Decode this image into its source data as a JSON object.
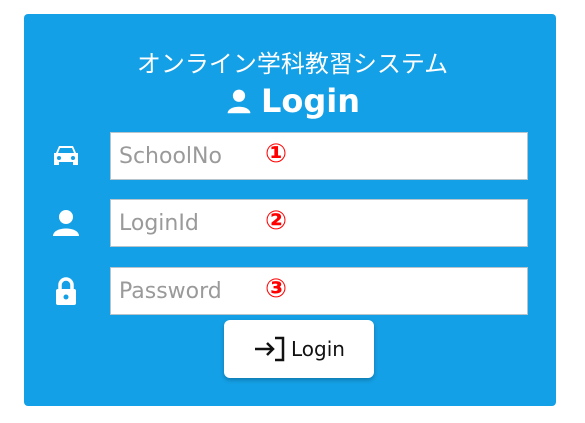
{
  "app": {
    "title": "オンライン学科教習システム",
    "heading": "Login"
  },
  "form": {
    "fields": [
      {
        "placeholder": "SchoolNo",
        "marker": "①",
        "icon": "car-icon"
      },
      {
        "placeholder": "LoginId",
        "marker": "②",
        "icon": "user-icon"
      },
      {
        "placeholder": "Password",
        "marker": "③",
        "icon": "lock-icon"
      }
    ],
    "submit_label": "Login",
    "submit_icon": "sign-in-icon"
  },
  "colors": {
    "panel": "#14a0e6",
    "marker": "#ff0000",
    "placeholder": "#9a9a9a"
  }
}
